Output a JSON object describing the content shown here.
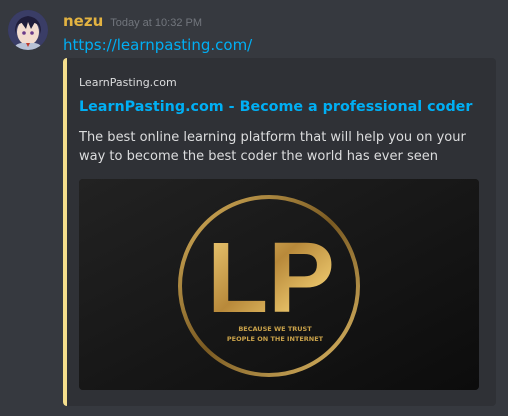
{
  "message": {
    "username": "nezu",
    "timestamp": "Today at 10:32 PM",
    "link_text": "https://learnpasting.com/"
  },
  "embed": {
    "accent_color": "#f5df8d",
    "provider": "LearnPasting.com",
    "title": "LearnPasting.com - Become a professional coder",
    "description": "The best online learning platform that will help you on your way to become the best coder the world has ever seen",
    "image": {
      "logo_letters": "LP",
      "tagline_line1": "BECAUSE WE TRUST",
      "tagline_line2": "PEOPLE ON THE INTERNET"
    }
  },
  "colors": {
    "background": "#36393f",
    "embed_background": "#2f3136",
    "username": "#e3b341",
    "link": "#00aff4",
    "gold": "#c9a24a"
  },
  "icons": {
    "avatar": "anime-avatar"
  }
}
